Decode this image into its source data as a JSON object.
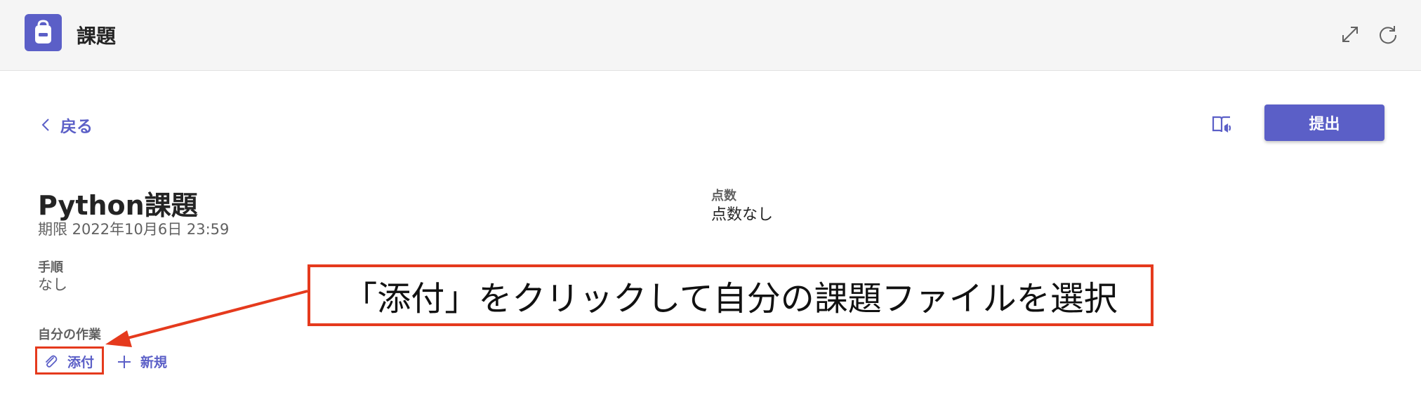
{
  "header": {
    "app_title": "課題",
    "app_icon": "backpack-icon"
  },
  "nav": {
    "back_label": "戻る",
    "submit_label": "提出"
  },
  "assignment": {
    "title": "Python課題",
    "due": "期限 2022年10月6日 23:59",
    "points_label": "点数",
    "points_value": "点数なし",
    "instructions_label": "手順",
    "instructions_value": "なし",
    "my_work_label": "自分の作業",
    "attach_label": "添付",
    "new_label": "新規"
  },
  "annotation": {
    "callout_text": "「添付」をクリックして自分の課題ファイルを選択"
  },
  "colors": {
    "accent": "#5b5fc7",
    "highlight": "#e53a1d"
  }
}
